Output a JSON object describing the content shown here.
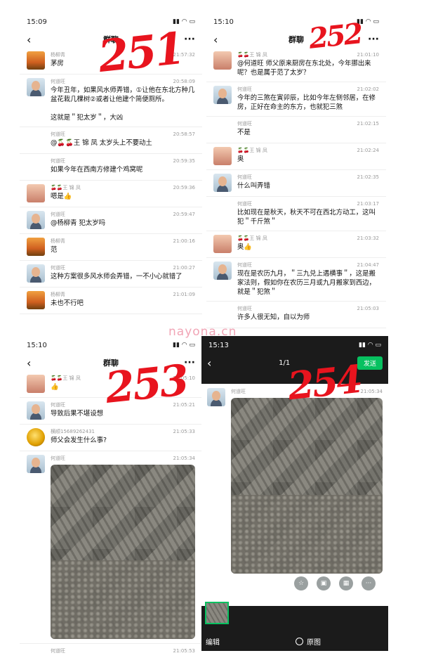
{
  "annotations": [
    "251",
    "252",
    "253",
    "254"
  ],
  "watermark": "nayona.cn",
  "panel_251": {
    "status_time": "15:09",
    "title": "群聊",
    "messages": [
      {
        "name": "杨柳青",
        "time": "21:57:32",
        "text": "茅房",
        "avatar": "sunset"
      },
      {
        "name": "何道旺",
        "time": "20:58:09",
        "text": "今年丑年，如果风水师弄错，①让他在东北方种几盆花栽几棵树②或者让他建个简便厕所。\n\n这就是＂犯太岁＂，大凶",
        "avatar": "man"
      },
      {
        "name": "何道旺",
        "time": "20:58:57",
        "text": "@🍒🍒王 锦 凤 太岁头上不要动土",
        "avatar": "none"
      },
      {
        "name": "何道旺",
        "time": "20:59:35",
        "text": "如果今年在西南方修建个鸡窝呢",
        "avatar": "none"
      },
      {
        "name": "🍒🍒王 锦 凤",
        "time": "20:59:36",
        "text": "嗯是👍",
        "avatar": "girl"
      },
      {
        "name": "何道旺",
        "time": "20:59:47",
        "text": "@杨柳青 犯太岁吗",
        "avatar": "man"
      },
      {
        "name": "杨柳青",
        "time": "21:00:16",
        "text": "范",
        "avatar": "sunset"
      },
      {
        "name": "何道旺",
        "time": "21:00:27",
        "text": "这种方案很多风水师会弄错，一不小心就错了",
        "avatar": "man"
      },
      {
        "name": "杨柳青",
        "time": "21:01:09",
        "text": "未也不行吧",
        "avatar": "sunset"
      }
    ]
  },
  "panel_252": {
    "status_time": "15:10",
    "title": "群聊",
    "messages": [
      {
        "name": "🍒🍒王 锦 凤",
        "time": "21:01:10",
        "text": "@何道旺 师父原来厨房在东北处，今年挪出来呢？也是属于范了太岁？",
        "avatar": "girl"
      },
      {
        "name": "何道旺",
        "time": "21:02:02",
        "text": "今年的三煞在寅卯辰，比如今年左侧邻居，在修房，正好在命主的东方，也就犯三煞",
        "avatar": "man"
      },
      {
        "name": "何道旺",
        "time": "21:02:15",
        "text": "不是",
        "avatar": "none"
      },
      {
        "name": "🍒🍒王 锦 凤",
        "time": "21:02:24",
        "text": "奥",
        "avatar": "girl"
      },
      {
        "name": "何道旺",
        "time": "21:02:35",
        "text": "什么叫弄错",
        "avatar": "man"
      },
      {
        "name": "何道旺",
        "time": "21:03:17",
        "text": "比如现在是秋天，秋天不可在西北方动工，这叫犯＂千斤煞＂",
        "avatar": "none"
      },
      {
        "name": "🍒🍒王 锦 凤",
        "time": "21:03:32",
        "text": "奥👍",
        "avatar": "girl"
      },
      {
        "name": "何道旺",
        "time": "21:04:47",
        "text": "现在是农历九月，＂三九兑上遇横事＂，这是搬家法则，假如你在农历三月或九月搬家到西边，就是＂犯煞＂",
        "avatar": "man"
      },
      {
        "name": "何道旺",
        "time": "21:05:03",
        "text": "许多人很无知，自以为师",
        "avatar": "none"
      }
    ]
  },
  "panel_253": {
    "status_time": "15:10",
    "title": "群聊",
    "messages": [
      {
        "name": "🍒🍒王 锦 凤",
        "time": "21:05:10",
        "text": "👍",
        "avatar": "girl"
      },
      {
        "name": "何道旺",
        "time": "21:05:21",
        "text": "导致后果不堪设想",
        "avatar": "man"
      },
      {
        "name": "横顺15689262431",
        "time": "21:05:33",
        "text": "师父会发生什么事?",
        "avatar": "gold"
      },
      {
        "name": "何道旺",
        "time": "21:05:34",
        "text": "",
        "avatar": "man",
        "photo": true
      },
      {
        "name": "何道旺",
        "time": "21:05:53",
        "text": "",
        "avatar": "none"
      }
    ]
  },
  "panel_254": {
    "status_time": "15:13",
    "counter": "1/1",
    "send_label": "发送",
    "sender": "何道旺",
    "time": "21:05:34",
    "edit_label": "编辑",
    "original_label": "原图"
  }
}
